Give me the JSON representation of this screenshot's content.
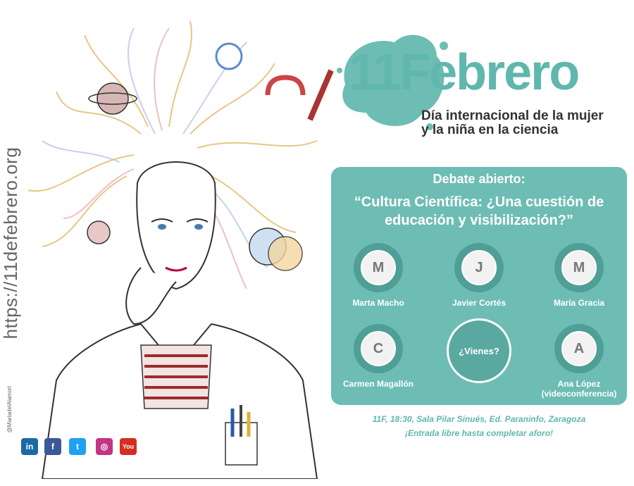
{
  "sidebar": {
    "url": "https://11defebrero.org",
    "credit": "@MariadelAlamort"
  },
  "brand": {
    "name": "11Febrero",
    "subtitle_line1": "Día internacional de la mujer",
    "subtitle_line2": "y la niña en la ciencia"
  },
  "event": {
    "kicker": "Debate abierto:",
    "title_line1": "“Cultura Científica: ¿Una cuestión de",
    "title_line2": "educación y visibilización?”",
    "speakers": [
      {
        "name": "Marta Macho",
        "initial": "M"
      },
      {
        "name": "Javier Cortés",
        "initial": "J"
      },
      {
        "name": "María Gracia",
        "initial": "M"
      },
      {
        "name": "Carmen Magallón",
        "initial": "C"
      },
      {
        "name": "Ana López",
        "note": "(videoconferencia)",
        "initial": "A"
      }
    ],
    "cta": "¿Vienes?"
  },
  "details": {
    "line1": "11F, 18:30, Sala Pilar Sinués, Ed. Paraninfo, Zaragoza",
    "line2": "¡Entrada libre hasta completar aforo!"
  },
  "social": [
    {
      "name": "linkedin",
      "label": "in",
      "color": "#1a6aa6"
    },
    {
      "name": "facebook",
      "label": "f",
      "color": "#3b5998"
    },
    {
      "name": "twitter",
      "label": "t",
      "color": "#1da1f2"
    },
    {
      "name": "instagram",
      "label": "◎",
      "color": "#c13584"
    },
    {
      "name": "youtube",
      "label": "You",
      "color": "#d62d20"
    }
  ],
  "colors": {
    "accent": "#6dbdb4",
    "brand": "#5fb7ad"
  }
}
